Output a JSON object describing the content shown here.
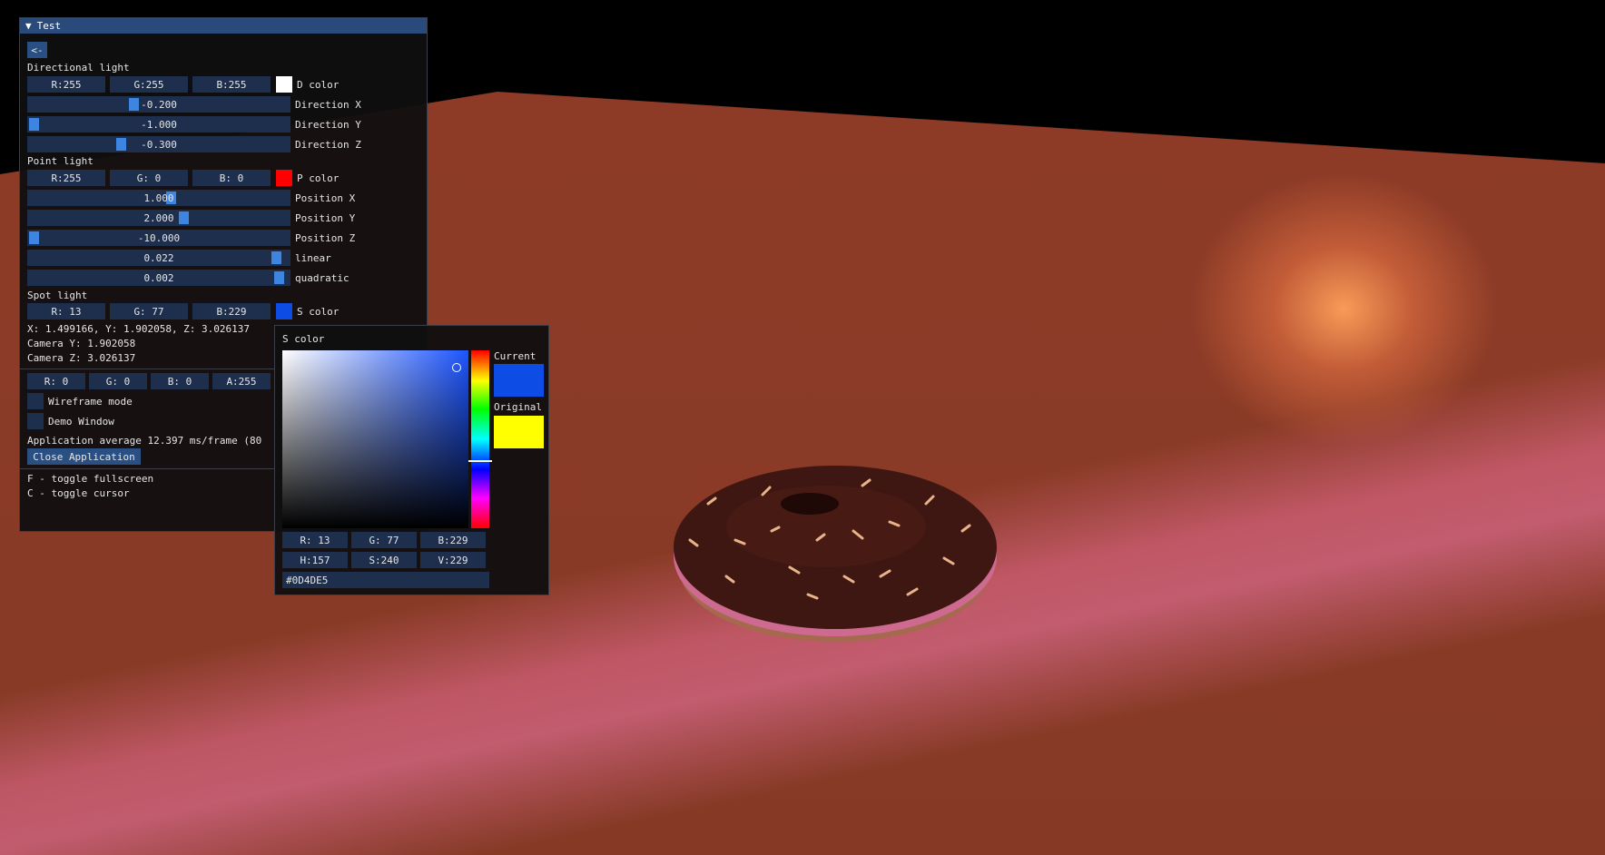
{
  "scene": {
    "colors": {
      "floor": "#8c3b27",
      "glow": "#ff9a5a",
      "pink_band": "#e58aa8",
      "donut_icing": "#3e1712",
      "donut_dough": "#b37a5c"
    }
  },
  "main_window": {
    "title": "Test",
    "back_button": "<-",
    "directional": {
      "header": "Directional light",
      "r": "R:255",
      "g": "G:255",
      "b": "B:255",
      "color_label": "D color",
      "color": "#ffffff",
      "sliders": [
        {
          "value_text": "-0.200",
          "label": "Direction X",
          "fraction": 0.4
        },
        {
          "value_text": "-1.000",
          "label": "Direction Y",
          "fraction": 0.0
        },
        {
          "value_text": "-0.300",
          "label": "Direction Z",
          "fraction": 0.35
        }
      ]
    },
    "point": {
      "header": "Point light",
      "r": "R:255",
      "g": "G:  0",
      "b": "B:  0",
      "color_label": "P color",
      "color": "#ff0000",
      "sliders": [
        {
          "value_text": "1.000",
          "label": "Position X",
          "fraction": 0.55
        },
        {
          "value_text": "2.000",
          "label": "Position Y",
          "fraction": 0.6
        },
        {
          "value_text": "-10.000",
          "label": "Position Z",
          "fraction": 0.0
        },
        {
          "value_text": "0.022",
          "label": "linear",
          "fraction": 0.97
        },
        {
          "value_text": "0.002",
          "label": "quadratic",
          "fraction": 0.98
        }
      ]
    },
    "spot": {
      "header": "Spot light",
      "r": "R: 13",
      "g": "G: 77",
      "b": "B:229",
      "color_label": "S color",
      "color": "#0d4de5"
    },
    "camera_lines": [
      "X: 1.499166, Y: 1.902058, Z: 3.026137",
      "Camera Y: 1.902058",
      "Camera Z: 3.026137"
    ],
    "rgba": {
      "r": "R:  0",
      "g": "G:  0",
      "b": "B:  0",
      "a": "A:255"
    },
    "wireframe_label": "Wireframe mode",
    "demo_label": "Demo Window",
    "perf_text": "Application average 12.397 ms/frame (80",
    "close_button": "Close Application",
    "help_lines": [
      "F - toggle fullscreen",
      "C - toggle cursor"
    ]
  },
  "picker": {
    "title": "S color",
    "current_label": "Current",
    "original_label": "Original",
    "current_color": "#0d4de5",
    "original_color": "#ffff00",
    "hue_fraction": 0.62,
    "rgb": [
      "R: 13",
      "G: 77",
      "B:229"
    ],
    "hsv": [
      "H:157",
      "S:240",
      "V:229"
    ],
    "hex": "#0D4DE5"
  }
}
